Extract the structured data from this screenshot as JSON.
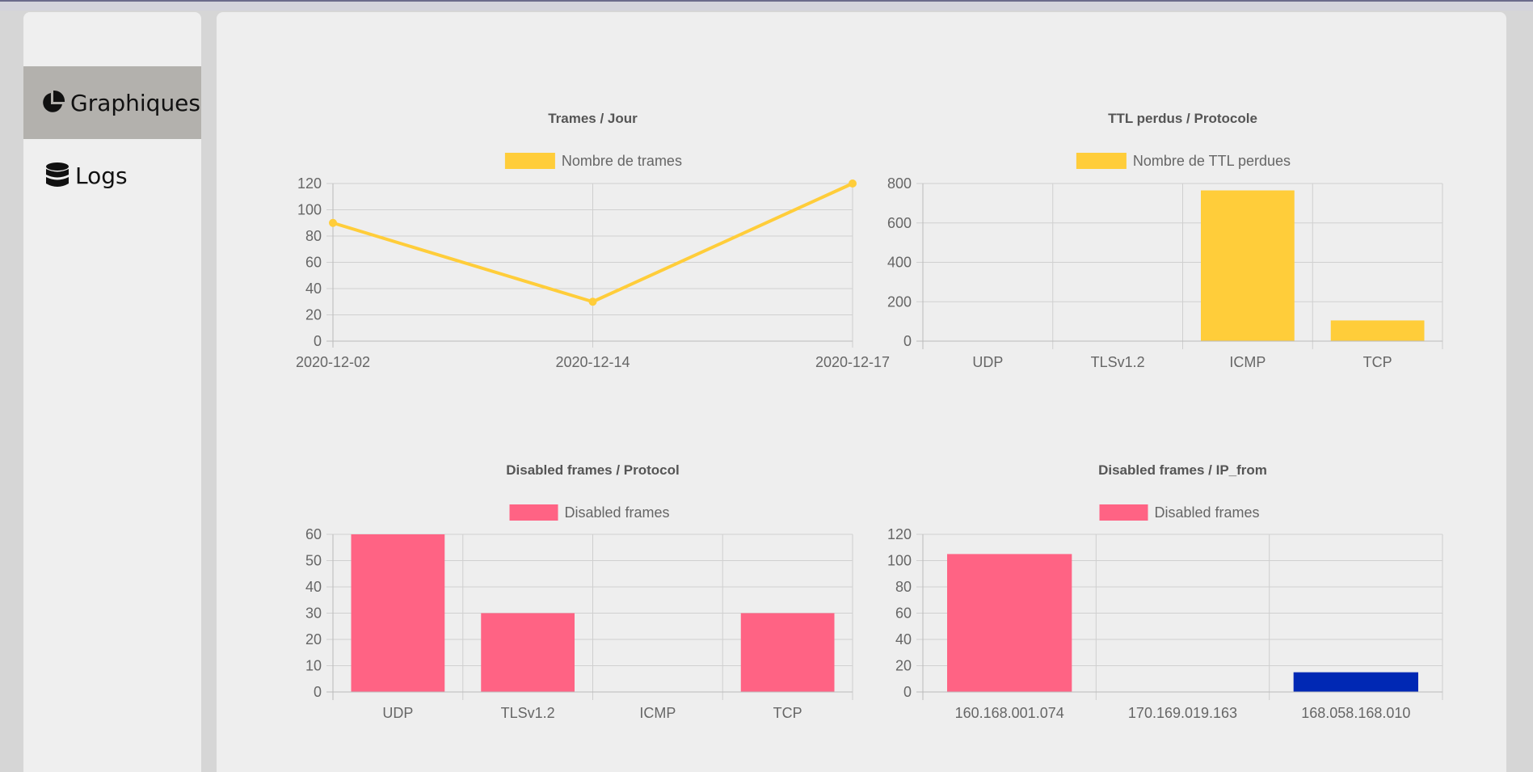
{
  "sidebar": {
    "items": [
      {
        "label": "Graphiques",
        "icon": "pie-chart-icon",
        "active": true
      },
      {
        "label": "Logs",
        "icon": "database-icon",
        "active": false
      }
    ]
  },
  "chart_data": [
    {
      "type": "line",
      "title": "Trames / Jour",
      "categories": [
        "2020-12-02",
        "2020-12-14",
        "2020-12-17"
      ],
      "series": [
        {
          "name": "Nombre de trames",
          "values": [
            90,
            30,
            120
          ],
          "color": "#ffcd3a"
        }
      ],
      "ylim": [
        0,
        120
      ],
      "yticks": [
        0,
        20,
        40,
        60,
        80,
        100,
        120
      ],
      "grid": true,
      "legend": "top"
    },
    {
      "type": "bar",
      "title": "TTL perdus / Protocole",
      "categories": [
        "UDP",
        "TLSv1.2",
        "ICMP",
        "TCP"
      ],
      "series": [
        {
          "name": "Nombre de TTL perdues",
          "values": [
            0,
            0,
            765,
            105
          ],
          "color": "#ffcd3a"
        }
      ],
      "ylim": [
        0,
        800
      ],
      "yticks": [
        0,
        200,
        400,
        600,
        800
      ],
      "grid": true,
      "legend": "top"
    },
    {
      "type": "bar",
      "title": "Disabled frames / Protocol",
      "categories": [
        "UDP",
        "TLSv1.2",
        "ICMP",
        "TCP"
      ],
      "series": [
        {
          "name": "Disabled frames",
          "values": [
            60,
            30,
            0,
            30
          ],
          "color": "#ff6384"
        }
      ],
      "ylim": [
        0,
        60
      ],
      "yticks": [
        0,
        10,
        20,
        30,
        40,
        50,
        60
      ],
      "grid": true,
      "legend": "top"
    },
    {
      "type": "bar",
      "title": "Disabled frames / IP_from",
      "categories": [
        "160.168.001.074",
        "170.169.019.163",
        "168.058.168.010"
      ],
      "series": [
        {
          "name": "Disabled frames",
          "values": [
            105,
            0,
            15
          ],
          "color": "#ff6384"
        }
      ],
      "bar_colors": [
        "#ff6384",
        "#ff6384",
        "#0028b4"
      ],
      "ylim": [
        0,
        120
      ],
      "yticks": [
        0,
        20,
        40,
        60,
        80,
        100,
        120
      ],
      "grid": true,
      "legend": "top"
    }
  ]
}
